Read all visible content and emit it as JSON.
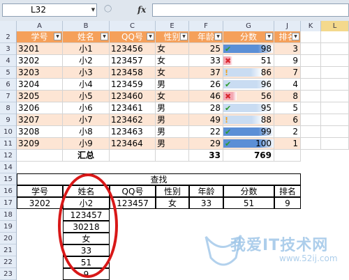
{
  "formula_bar": {
    "name_box": "L32",
    "fx": "fx",
    "formula": ""
  },
  "columns": [
    "A",
    "B",
    "C",
    "E",
    "F",
    "G",
    "J",
    "K",
    "L"
  ],
  "rows": [
    "2",
    "3",
    "4",
    "5",
    "6",
    "7",
    "8",
    "9",
    "10",
    "11",
    "12",
    "14",
    "15",
    "16",
    "17",
    "18",
    "19",
    "20",
    "21",
    "22",
    "23"
  ],
  "table_headers": [
    "学号",
    "姓名",
    "QQ号",
    "性别",
    "年龄",
    "分数",
    "排名"
  ],
  "records": [
    {
      "id": "3201",
      "name": "小1",
      "qq": "123456",
      "sex": "女",
      "age": "25",
      "icon": "check",
      "score": "98",
      "fill": 0.98,
      "rank": "3"
    },
    {
      "id": "3202",
      "name": "小2",
      "qq": "123457",
      "sex": "女",
      "age": "33",
      "icon": "cross",
      "score": "51",
      "fill": 0.51,
      "rank": "9"
    },
    {
      "id": "3203",
      "name": "小3",
      "qq": "123458",
      "sex": "女",
      "age": "37",
      "icon": "warn",
      "score": "86",
      "fill": 0.86,
      "rank": "7"
    },
    {
      "id": "3204",
      "name": "小4",
      "qq": "123459",
      "sex": "男",
      "age": "26",
      "icon": "check",
      "score": "96",
      "fill": 0.96,
      "rank": "4"
    },
    {
      "id": "3205",
      "name": "小5",
      "qq": "123460",
      "sex": "女",
      "age": "46",
      "icon": "cross",
      "score": "56",
      "fill": 0.56,
      "rank": "8"
    },
    {
      "id": "3206",
      "name": "小6",
      "qq": "123461",
      "sex": "男",
      "age": "28",
      "icon": "check",
      "score": "95",
      "fill": 0.95,
      "rank": "5"
    },
    {
      "id": "3207",
      "name": "小7",
      "qq": "123462",
      "sex": "男",
      "age": "49",
      "icon": "warn",
      "score": "88",
      "fill": 0.88,
      "rank": "6"
    },
    {
      "id": "3208",
      "name": "小8",
      "qq": "123463",
      "sex": "男",
      "age": "22",
      "icon": "check",
      "score": "99",
      "fill": 0.99,
      "rank": "2"
    },
    {
      "id": "3209",
      "name": "小9",
      "qq": "123464",
      "sex": "男",
      "age": "29",
      "icon": "check",
      "score": "100",
      "fill": 1.0,
      "rank": "1"
    }
  ],
  "summary": {
    "label": "汇总",
    "age_total": "33",
    "score_total": "769"
  },
  "lookup": {
    "title": "查找",
    "headers": [
      "学号",
      "姓名",
      "QQ号",
      "性别",
      "年龄",
      "分数",
      "排名"
    ],
    "values": [
      "3202",
      "小2",
      "123457",
      "女",
      "33",
      "51",
      "9"
    ],
    "list": [
      "123457",
      "30218",
      "女",
      "33",
      "51",
      "9"
    ]
  },
  "watermark": {
    "text": "我爱IT技术网",
    "url": "www.52ij.com"
  },
  "colors": {
    "header_bg": "#f5a05a",
    "row_peach": "#fde5d4",
    "bar_blue": "#5b8fd6",
    "bar_pink": "#f4a7b2",
    "bar_light": "#c9dcf2",
    "check": "#2e9b2e",
    "cross": "#d9262e",
    "warn": "#f0a020",
    "circle": "#d81818"
  }
}
